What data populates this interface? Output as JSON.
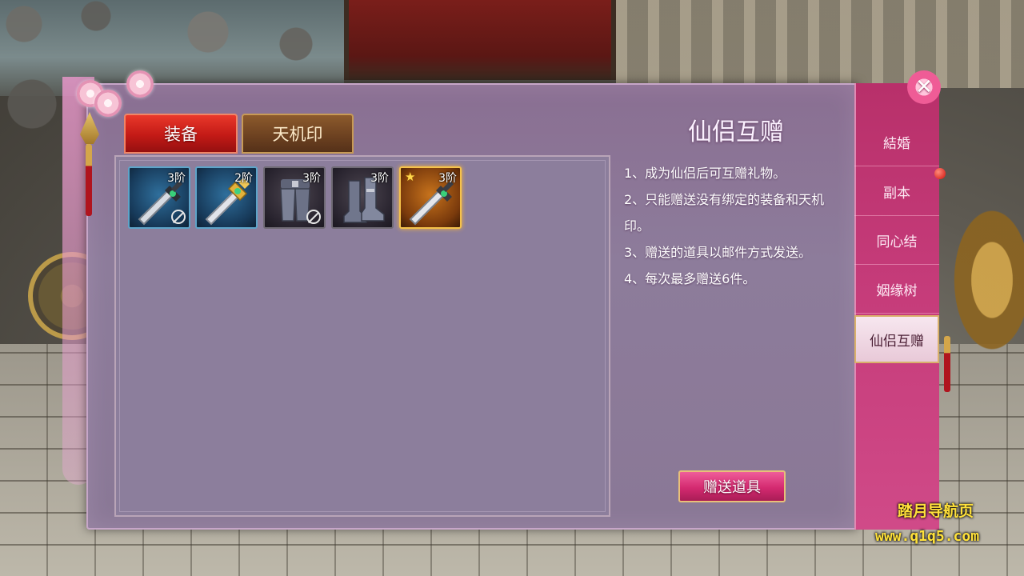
{
  "tabs": {
    "equipment": "装备",
    "tianji_seal": "天机印"
  },
  "panel": {
    "title": "仙侣互赠",
    "rules": [
      "1、成为仙侣后可互赠礼物。",
      "2、只能赠送没有绑定的装备和天机印。",
      "3、赠送的道具以邮件方式发送。",
      "4、每次最多赠送6件。"
    ],
    "gift_button": "赠送道具"
  },
  "inventory": [
    {
      "name": "sword",
      "tier": "3阶",
      "frame": "blue",
      "bound": true,
      "starred": false
    },
    {
      "name": "golden-sword",
      "tier": "2阶",
      "frame": "blue",
      "bound": false,
      "starred": false
    },
    {
      "name": "leg-armor",
      "tier": "3阶",
      "frame": "grey",
      "bound": true,
      "starred": false
    },
    {
      "name": "boots",
      "tier": "3阶",
      "frame": "grey",
      "bound": false,
      "starred": false
    },
    {
      "name": "sword",
      "tier": "3阶",
      "frame": "gold",
      "bound": false,
      "starred": true
    }
  ],
  "sidebar": {
    "items": [
      {
        "label": "結婚",
        "active": false
      },
      {
        "label": "副本",
        "active": false
      },
      {
        "label": "同心结",
        "active": false
      },
      {
        "label": "姻缘树",
        "active": false
      },
      {
        "label": "仙侣互赠",
        "active": true
      }
    ]
  },
  "close": "✕",
  "watermark": {
    "line1": "踏月导航页",
    "line2": "www.q1q5.com"
  },
  "colors": {
    "panel_bg": "#8a7896",
    "active_tab": "#c31a16",
    "sidebar": "#c43a78",
    "accent_gold": "#e8c079",
    "watermark": "#ffe13a"
  }
}
